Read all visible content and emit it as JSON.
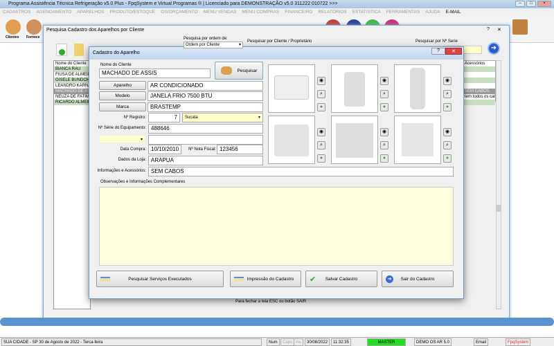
{
  "window": {
    "title": "Programa Assistência Técnica Refrigeração v5.0 Plus - FpqSystem e Virtual Programas ® | Licenciado para  DEMONSTRAÇÃO v5.0 311222 010722 >>>"
  },
  "menu": [
    "CADASTROS",
    "AGENDAMENTO",
    "APARELHOS",
    "PRODUTO/ESTOQUE",
    "OS/ORÇAMENTO",
    "MENU VENDAS",
    "MENU COMPRAS",
    "FINANCEIRO",
    "RELATÓRIOS",
    "ESTATISTICA",
    "FERRAMENTAS",
    "AJUDA",
    "E-MAIL"
  ],
  "toolbar": {
    "clientes": "Clientes",
    "fornece": "Fornece"
  },
  "search_dialog": {
    "title": "Pesquisa Cadastro dos Aparelhos por Cliente",
    "order_label": "Pesquisa por ordem de:",
    "order_value": "Ordem por Cliente",
    "client_label": "Pesquisar por Cliente / Proprietário",
    "serial_label": "Pesquisar por Nº Serie",
    "list_header": "Nome do Cliente",
    "clients": [
      "BIANCA RAU",
      "FIUSA DE ALMEIDA",
      "GISELE BUNDCHEN",
      "LEANDRO KARNAL",
      "MACHADO DE ASSIS",
      "NEUZA DE FATIMA",
      "RICARDO ALMEIDA"
    ],
    "acc_header": "Acessórios",
    "acc_rows": [
      "",
      "",
      "",
      "",
      "SEM CABOS",
      "tem todos os cab",
      ""
    ],
    "hint": "Para fechar a tela ESC ou botão SAIR"
  },
  "form": {
    "title": "Cadastro do Aparelho",
    "client_label": "Nome do Cliente",
    "client": "MACHADO DE ASSIS",
    "search_btn": "Pesquisar",
    "aparelho_btn": "Aparelho",
    "aparelho": "AR CONDICIONADO",
    "modelo_btn": "Modelo",
    "modelo": "JANELA FRIO 7500 BTU",
    "marca_btn": "Marca",
    "marca": "BRASTEMP",
    "registro_label": "Nº Registro:",
    "registro": "7",
    "status": "Sucata",
    "serie_label": "Nº Série do Equipamento:",
    "serie": "488646",
    "compra_label": "Data Compra:",
    "compra": "10/10/2010",
    "nf_label": "Nº Nota Fiscal:",
    "nf": "123456",
    "loja_label": "Dados da Loja:",
    "loja": "ARAPUA",
    "info_label": "Informações e Acessórios:",
    "info": "SEM CABOS",
    "obs_label": "Observações e Informações Complementares",
    "obs": "",
    "btn_servicos": "Pesquisar Serviços Executados",
    "btn_impressao": "Impressão do Cadastro",
    "btn_salvar": "Salvar Cadastro",
    "btn_sair": "Sair do Cadastro"
  },
  "status": {
    "city": "SUA CIDADE - SP 30 de Agosto de 2022 - Terca-feira",
    "num": "Num",
    "caps": "Caps",
    "ins": "Ins",
    "date": "30/08/2022",
    "time": "11:32:35",
    "user": "MASTER",
    "demo": "DEMO OS AR 5.0",
    "email": "Email",
    "brand": "FpqSystem"
  },
  "colors": {
    "accent": "#5b93cf",
    "master": "#22dd22",
    "field_yellow": "#ffffcc"
  }
}
